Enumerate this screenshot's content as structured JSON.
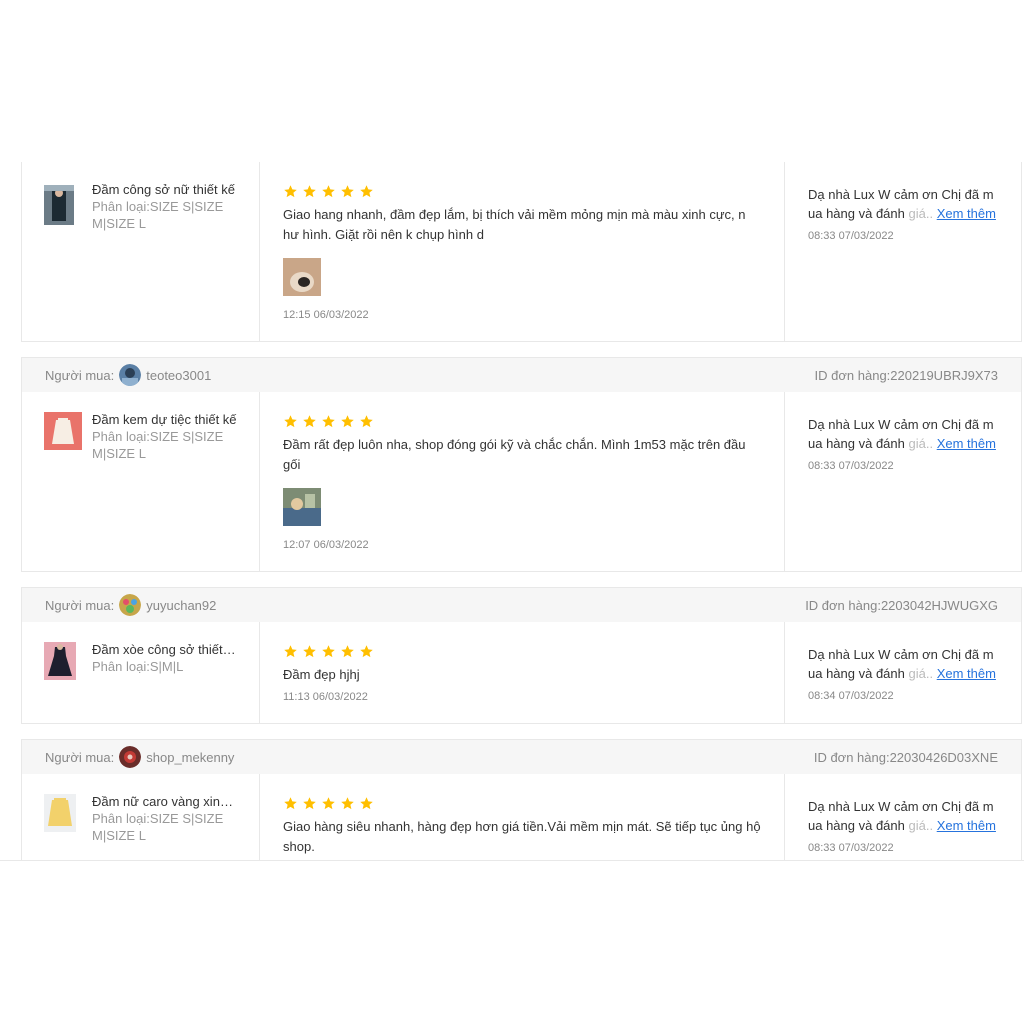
{
  "labels": {
    "buyer_prefix": "Người mua:",
    "order_prefix": "ID đơn hàng:",
    "see_more": "Xem thêm"
  },
  "colors": {
    "star": "#ffbf00",
    "link": "#2673dd"
  },
  "reviews": [
    {
      "buyer": "",
      "order_id": "",
      "product_name": "Đầm công sở nữ thiết kế",
      "product_variant": "Phân loại:SIZE S|SIZE M|SIZE L",
      "rating": 5,
      "text": "Giao hang nhanh, đầm đẹp lắm, bị thích vải mềm mỏng mịn mà màu xinh cực, n hư hình. Giặt rồi nên k chụp hình d",
      "has_image": true,
      "review_time": "12:15 06/03/2022",
      "reply_text": "Dạ nhà Lux W cảm ơn Chị đã m ua hàng và đánh",
      "reply_faded": "giá..",
      "reply_time": "08:33 07/03/2022"
    },
    {
      "buyer": "teoteo3001",
      "order_id": "220219UBRJ9X73",
      "product_name": "Đầm kem dự tiệc thiết kế",
      "product_variant": "Phân loại:SIZE S|SIZE M|SIZE L",
      "rating": 5,
      "text": "Đầm rất đẹp luôn nha, shop đóng gói kỹ và chắc chắn. Mình 1m53 mặc trên đầu gối",
      "has_image": true,
      "review_time": "12:07 06/03/2022",
      "reply_text": "Dạ nhà Lux W cảm ơn Chị đã m ua hàng và đánh",
      "reply_faded": "giá..",
      "reply_time": "08:33 07/03/2022"
    },
    {
      "buyer": "yuyuchan92",
      "order_id": "2203042HJWUGXG",
      "product_name": "Đầm xòe công sở thiết kế",
      "product_variant": "Phân loại:S|M|L",
      "rating": 5,
      "text": "Đầm đẹp hjhj",
      "has_image": false,
      "review_time": "11:13 06/03/2022",
      "reply_text": "Dạ nhà Lux W cảm ơn Chị đã m ua hàng và đánh",
      "reply_faded": "giá..",
      "reply_time": "08:34 07/03/2022"
    },
    {
      "buyer": "shop_mekenny",
      "order_id": "22030426D03XNE",
      "product_name": "Đầm nữ caro vàng xinh xắn",
      "product_variant": "Phân loại:SIZE S|SIZE M|SIZE L",
      "rating": 5,
      "text": "Giao hàng siêu nhanh, hàng đẹp hơn giá tiền.Vải mềm mịn mát. Sẽ tiếp tục ủng hộ shop.",
      "has_image": false,
      "review_time": "",
      "reply_text": "Dạ nhà Lux W cảm ơn Chị đã m ua hàng và đánh",
      "reply_faded": "giá..",
      "reply_time": "08:33 07/03/2022"
    }
  ]
}
